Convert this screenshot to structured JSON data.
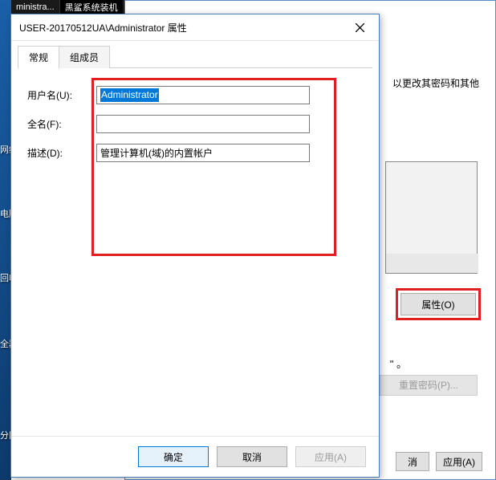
{
  "taskbar": {
    "items": [
      "ministra...",
      "黑鲨系统装机"
    ]
  },
  "desktop_labels": [
    "网络",
    "电脑",
    "回收站",
    "全器",
    "分区"
  ],
  "bg_dialog": {
    "hint": "以更改其密码和其他",
    "prop_button": "属性(O)",
    "quote_tail": "。",
    "reset_pw": "重置密码(P)...",
    "buttons": {
      "cancel": "消",
      "apply": "应用(A)"
    }
  },
  "dialog": {
    "title": "USER-20170512UA\\Administrator 属性",
    "tabs": {
      "general": "常规",
      "memberof": "组成员"
    },
    "fields": {
      "username_label": "用户名(U):",
      "username_value": "Administrator",
      "fullname_label": "全名(F):",
      "fullname_value": "",
      "desc_label": "描述(D):",
      "desc_value": "管理计算机(域)的内置帐户"
    },
    "buttons": {
      "ok": "确定",
      "cancel": "取消",
      "apply": "应用(A)"
    }
  }
}
